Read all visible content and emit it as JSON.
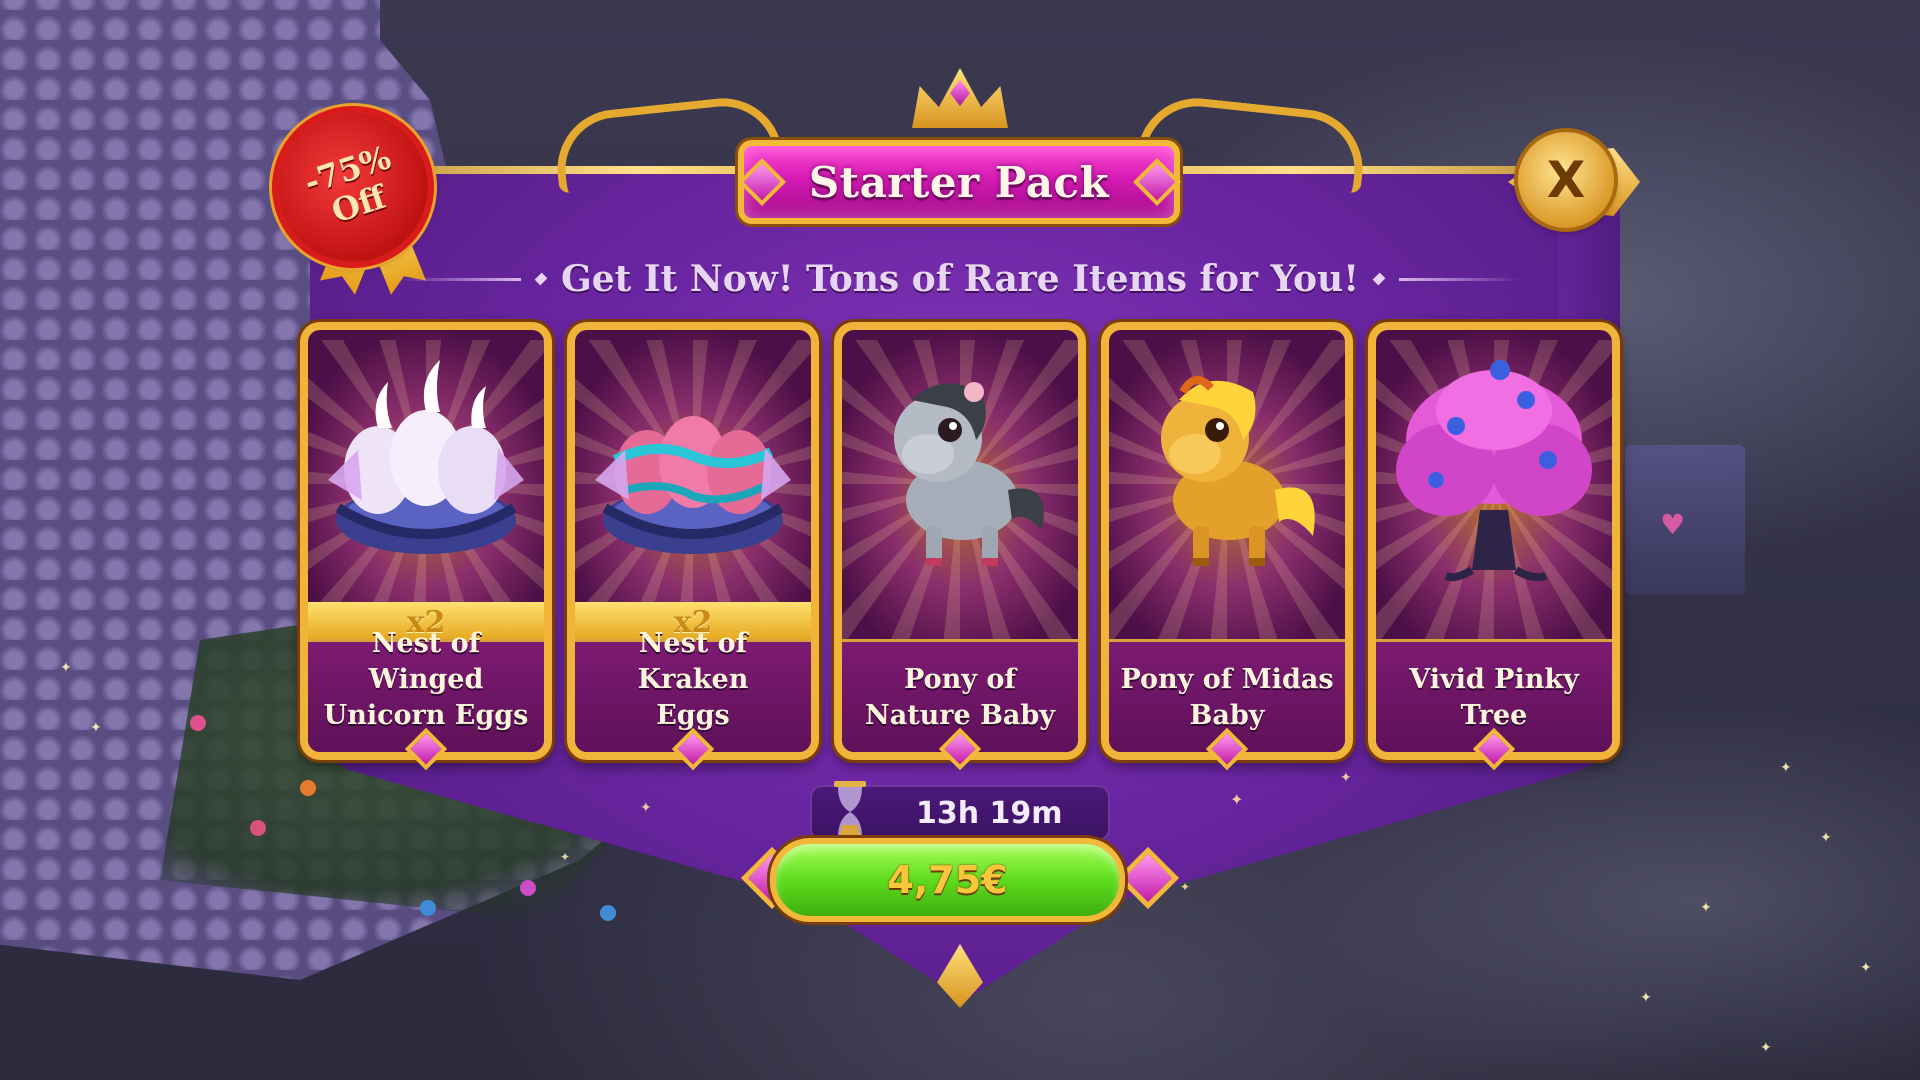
{
  "dialog": {
    "title": "Starter Pack",
    "subtitle": "Get It Now! Tons of Rare Items for You!",
    "discount_badge": "-75%\nOff",
    "close_symbol": "X",
    "timer": "13h 19m",
    "price": "4,75€"
  },
  "items": [
    {
      "name": "Nest of Winged\nUnicorn Eggs",
      "quantity": "x2",
      "icon": "winged-unicorn-eggs-nest"
    },
    {
      "name": "Nest of Kraken\nEggs",
      "quantity": "x2",
      "icon": "kraken-eggs-nest"
    },
    {
      "name": "Pony of\nNature Baby",
      "quantity": "",
      "icon": "grey-pony"
    },
    {
      "name": "Pony of Midas\nBaby",
      "quantity": "",
      "icon": "golden-pony"
    },
    {
      "name": "Vivid Pinky\nTree",
      "quantity": "",
      "icon": "pink-tree"
    }
  ],
  "colors": {
    "banner_purple": "#6b26a3",
    "title_magenta": "#d61bb4",
    "gold_frame": "#f0b43a",
    "price_green": "#5fdc1c",
    "seal_red": "#c11212"
  }
}
